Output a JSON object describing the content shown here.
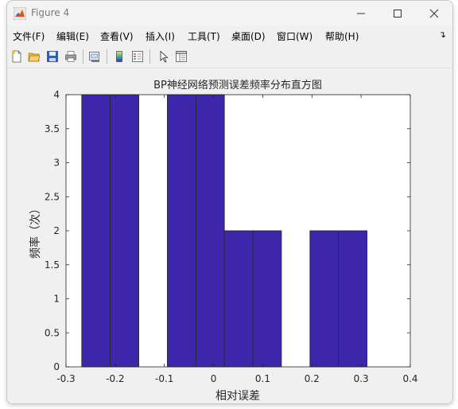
{
  "window": {
    "title": "Figure 4"
  },
  "menubar": {
    "items": [
      {
        "label": "文件(F)"
      },
      {
        "label": "编辑(E)"
      },
      {
        "label": "查看(V)"
      },
      {
        "label": "插入(I)"
      },
      {
        "label": "工具(T)"
      },
      {
        "label": "桌面(D)"
      },
      {
        "label": "窗口(W)"
      },
      {
        "label": "帮助(H)"
      }
    ],
    "overflow_icon": "dock-arrow-icon"
  },
  "toolbar": {
    "buttons": [
      {
        "icon": "new-figure-icon"
      },
      {
        "icon": "open-file-icon"
      },
      {
        "icon": "save-icon"
      },
      {
        "icon": "print-icon"
      },
      {
        "icon": "link-plot-icon"
      },
      {
        "icon": "insert-colorbar-icon"
      },
      {
        "icon": "insert-legend-icon"
      },
      {
        "icon": "edit-plot-arrow-icon"
      },
      {
        "icon": "property-inspector-icon"
      }
    ]
  },
  "chart_data": {
    "type": "bar",
    "title": "BP神经网络预测误差频率分布直方图",
    "xlabel": "相对误差",
    "ylabel": "频率（次）",
    "xlim": [
      -0.3,
      0.4
    ],
    "ylim": [
      0,
      4
    ],
    "xticks": [
      "-0.3",
      "-0.2",
      "-0.1",
      "0",
      "0.1",
      "0.2",
      "0.3",
      "0.4"
    ],
    "yticks": [
      "0",
      "0.5",
      "1",
      "1.5",
      "2",
      "2.5",
      "3",
      "3.5",
      "4"
    ],
    "bin_edges": [
      -0.268,
      -0.21,
      -0.152,
      -0.094,
      -0.036,
      0.022,
      0.08,
      0.138,
      0.196,
      0.254,
      0.312
    ],
    "values": [
      4,
      4,
      0,
      4,
      4,
      2,
      2,
      0,
      2,
      2
    ],
    "bar_color": "#3d26a9",
    "grid": false
  }
}
